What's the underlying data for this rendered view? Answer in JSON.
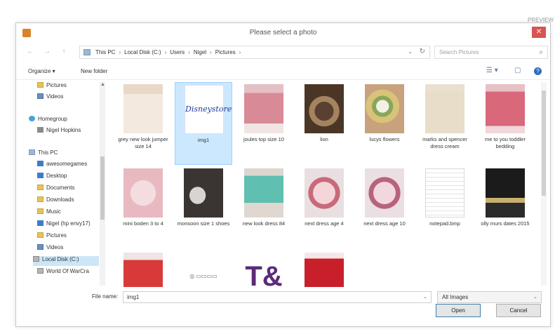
{
  "background_label": "PREVIEW MODE",
  "window": {
    "title": "Please select a photo",
    "close_glyph": "✕"
  },
  "nav_buttons": {
    "back": "←",
    "forward": "→",
    "up": "↑"
  },
  "address": {
    "crumbs": [
      "This PC",
      "Local Disk (C:)",
      "Users",
      "Nigel",
      "Pictures"
    ],
    "separator": "›",
    "dropdown_glyph": "⌄",
    "refresh_glyph": "↻"
  },
  "search": {
    "placeholder": "Search Pictures",
    "icon_glyph": "⌕"
  },
  "toolbar": {
    "organize_label": "Organize ▾",
    "new_folder_label": "New folder",
    "view_glyph": "☰ ▾",
    "pane_glyph": "▢",
    "help_glyph": "?"
  },
  "sidebar": {
    "items": [
      {
        "label": "Pictures",
        "icon": "folder-icon"
      },
      {
        "label": "Videos",
        "icon": "video-icon"
      },
      {
        "label": "Homegroup",
        "icon": "homegroup-icon"
      },
      {
        "label": "Nigel Hopkins",
        "icon": "user-icon"
      },
      {
        "label": "This PC",
        "icon": "pc-icon"
      },
      {
        "label": "awesomegames",
        "icon": "folder-icon"
      },
      {
        "label": "Desktop",
        "icon": "folder-icon"
      },
      {
        "label": "Documents",
        "icon": "folder-icon"
      },
      {
        "label": "Downloads",
        "icon": "folder-icon"
      },
      {
        "label": "Music",
        "icon": "folder-icon"
      },
      {
        "label": "Nigel (hp envy17)",
        "icon": "folder-icon"
      },
      {
        "label": "Pictures",
        "icon": "folder-icon"
      },
      {
        "label": "Videos",
        "icon": "video-icon"
      },
      {
        "label": "Local Disk (C:)",
        "icon": "drive-icon"
      },
      {
        "label": "World Of WarCra",
        "icon": "drive-icon"
      }
    ]
  },
  "files": [
    {
      "name": "grey new look jumper size 14"
    },
    {
      "name": "img1",
      "thumb_text": "Disneystore"
    },
    {
      "name": "joules top size 10"
    },
    {
      "name": "lion"
    },
    {
      "name": "lucys flowers"
    },
    {
      "name": "marks and spencer dress cream"
    },
    {
      "name": "me to you toddler bedding"
    },
    {
      "name": "mini boden 3 to 4"
    },
    {
      "name": "monsoon size 1 shoes"
    },
    {
      "name": "new look dress 84"
    },
    {
      "name": "next dress age 4"
    },
    {
      "name": "next dress age 10"
    },
    {
      "name": "notepad.bmp"
    },
    {
      "name": "olly murs dates 2015"
    },
    {
      "name": ""
    },
    {
      "name": "",
      "thumb_text": "◎ ▭▭▭▭"
    },
    {
      "name": "",
      "thumb_text": "T&"
    },
    {
      "name": ""
    }
  ],
  "footer": {
    "file_name_label": "File name:",
    "file_name_value": "img1",
    "filter_value": "All Images",
    "dropdown_glyph": "⌄",
    "open_label": "Open",
    "cancel_label": "Cancel"
  }
}
